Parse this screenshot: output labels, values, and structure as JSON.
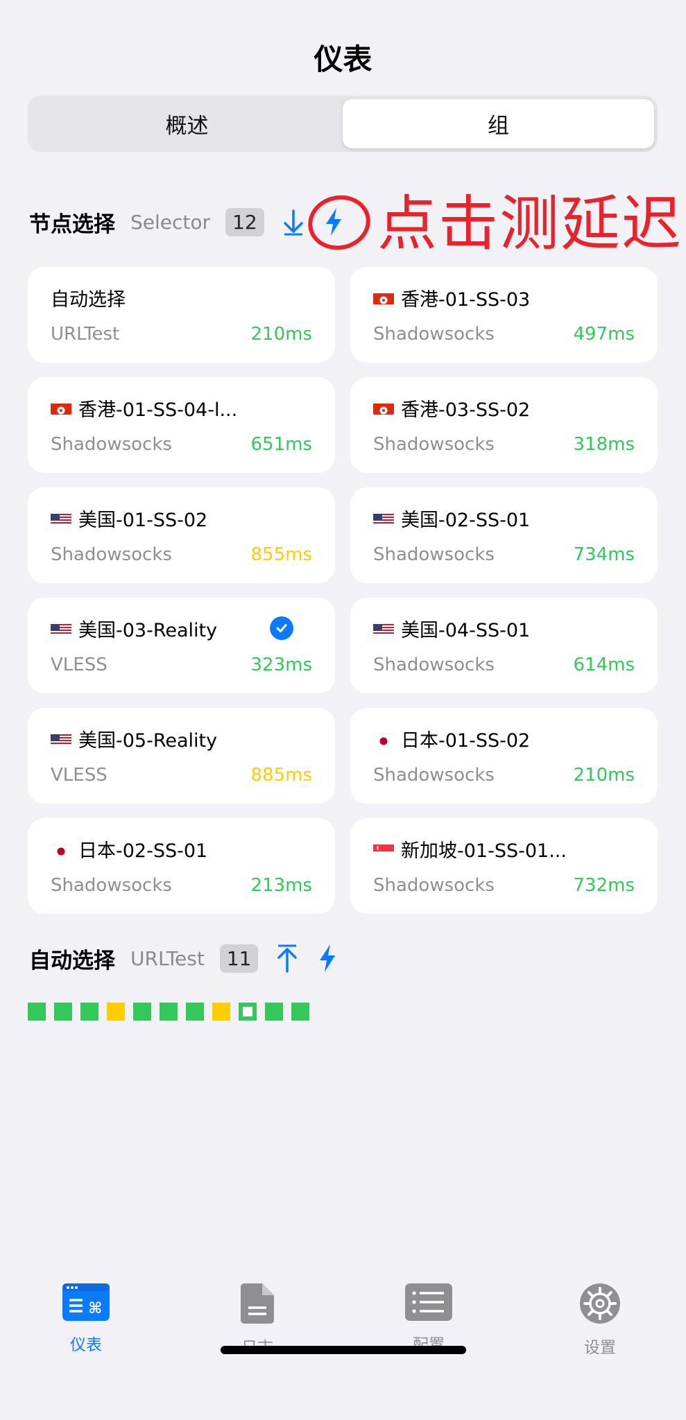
{
  "header": {
    "title": "仪表"
  },
  "segmented": {
    "overview": "概述",
    "groups": "组"
  },
  "group1": {
    "title": "节点选择",
    "type": "Selector",
    "count": "12",
    "icons": [
      "download-arrow-icon",
      "lightning-icon"
    ]
  },
  "annotation": {
    "text": "点击测延迟"
  },
  "nodes": [
    {
      "name": "自动选择",
      "flag": "",
      "type": "URLTest",
      "delay": "210ms",
      "status": "green",
      "selected": false
    },
    {
      "name": "香港-01-SS-03",
      "flag": "hk",
      "type": "Shadowsocks",
      "delay": "497ms",
      "status": "green",
      "selected": false
    },
    {
      "name": "香港-01-SS-04-l...",
      "flag": "hk",
      "type": "Shadowsocks",
      "delay": "651ms",
      "status": "green",
      "selected": false
    },
    {
      "name": "香港-03-SS-02",
      "flag": "hk",
      "type": "Shadowsocks",
      "delay": "318ms",
      "status": "green",
      "selected": false
    },
    {
      "name": "美国-01-SS-02",
      "flag": "us",
      "type": "Shadowsocks",
      "delay": "855ms",
      "status": "yellow",
      "selected": false
    },
    {
      "name": "美国-02-SS-01",
      "flag": "us",
      "type": "Shadowsocks",
      "delay": "734ms",
      "status": "green",
      "selected": false
    },
    {
      "name": "美国-03-Reality",
      "flag": "us",
      "type": "VLESS",
      "delay": "323ms",
      "status": "green",
      "selected": true
    },
    {
      "name": "美国-04-SS-01",
      "flag": "us",
      "type": "Shadowsocks",
      "delay": "614ms",
      "status": "green",
      "selected": false
    },
    {
      "name": "美国-05-Reality",
      "flag": "us",
      "type": "VLESS",
      "delay": "885ms",
      "status": "yellow",
      "selected": false
    },
    {
      "name": "日本-01-SS-02",
      "flag": "jp",
      "type": "Shadowsocks",
      "delay": "210ms",
      "status": "green",
      "selected": false
    },
    {
      "name": "日本-02-SS-01",
      "flag": "jp",
      "type": "Shadowsocks",
      "delay": "213ms",
      "status": "green",
      "selected": false
    },
    {
      "name": "新加坡-01-SS-01...",
      "flag": "sg",
      "type": "Shadowsocks",
      "delay": "732ms",
      "status": "green",
      "selected": false
    }
  ],
  "group2": {
    "title": "自动选择",
    "type": "URLTest",
    "count": "11",
    "icons": [
      "upload-arrow-icon",
      "lightning-icon"
    ],
    "statuses": [
      "green",
      "green",
      "green",
      "yellow",
      "green",
      "green",
      "green",
      "yellow",
      "selected",
      "green",
      "green"
    ]
  },
  "colors": {
    "accent": "#0a7aff",
    "green": "#34c759",
    "yellow": "#ffcc00",
    "annotation": "#e8232b"
  },
  "tabbar": {
    "items": [
      {
        "label": "仪表",
        "icon": "dashboard-icon",
        "active": true
      },
      {
        "label": "日志",
        "icon": "document-icon",
        "active": false
      },
      {
        "label": "配置",
        "icon": "list-icon",
        "active": false
      },
      {
        "label": "设置",
        "icon": "gear-icon",
        "active": false
      }
    ]
  }
}
